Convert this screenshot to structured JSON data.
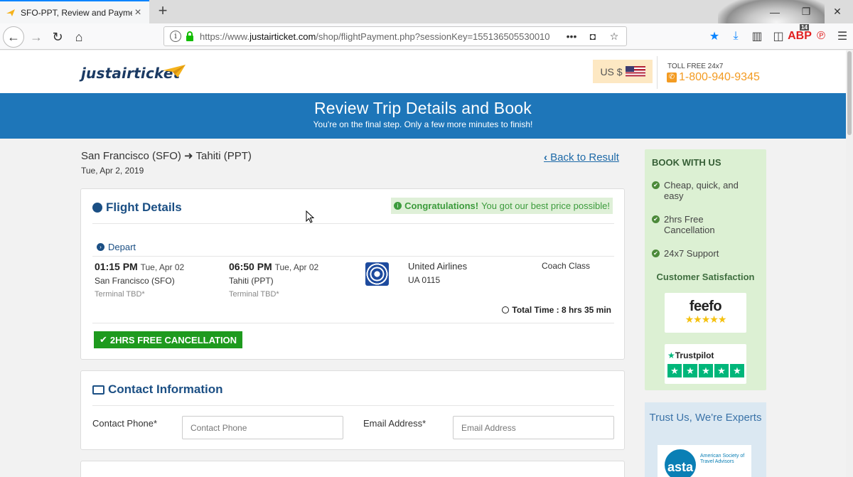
{
  "browser": {
    "tab_title": "SFO-PPT, Review and Payment",
    "url_prefix": "https://www.",
    "url_domain": "justairticket.com",
    "url_path": "/shop/flightPayment.php?sessionKey=155136505530010",
    "badge_count": "14",
    "abp_label": "ABP"
  },
  "header": {
    "logo": "justairticket",
    "currency": "US $",
    "toll_free_label": "TOLL FREE 24x7",
    "phone": "1-800-940-9345"
  },
  "banner": {
    "title": "Review Trip Details and Book",
    "subtitle": "You're on the final step. Only a few more minutes to finish!"
  },
  "trip": {
    "origin": "San Francisco (SFO)",
    "destination": "Tahiti (PPT)",
    "date": "Tue, Apr 2, 2019",
    "back_link": "Back to Result"
  },
  "flight": {
    "title": "Flight Details",
    "congrats_bold": "Congratulations!",
    "congrats_text": "You got our best price possible!",
    "depart_label": "Depart",
    "depart_time": "01:15 PM",
    "depart_date": "Tue, Apr 02",
    "depart_city": "San Francisco (SFO)",
    "depart_terminal": "Terminal TBD*",
    "arrive_time": "06:50 PM",
    "arrive_date": "Tue, Apr 02",
    "arrive_city": "Tahiti (PPT)",
    "arrive_terminal": "Terminal TBD*",
    "airline": "United Airlines",
    "flight_number": "UA 0115",
    "cabin": "Coach Class",
    "total_time": "Total Time : 8 hrs 35 min",
    "free_cancel": "2HRS FREE CANCELLATION"
  },
  "contact": {
    "title": "Contact Information",
    "phone_label": "Contact Phone*",
    "phone_placeholder": "Contact Phone",
    "email_label": "Email Address*",
    "email_placeholder": "Email Address"
  },
  "sidebar": {
    "book_title": "BOOK WITH US",
    "items": [
      "Cheap, quick, and easy",
      "2hrs Free Cancellation",
      "24x7 Support"
    ],
    "satisfaction": "Customer Satisfaction",
    "feefo": "feefo",
    "trustpilot": "Trustpilot",
    "trust_title": "Trust Us, We're Experts",
    "asta": "asta",
    "asta_text": "American Society of Travel Advisors"
  },
  "colors": {
    "primary_blue": "#1e76b9",
    "phone_orange": "#f39b22",
    "success_green": "#1e9a1e",
    "sidebar_green": "#dcf0d3"
  }
}
